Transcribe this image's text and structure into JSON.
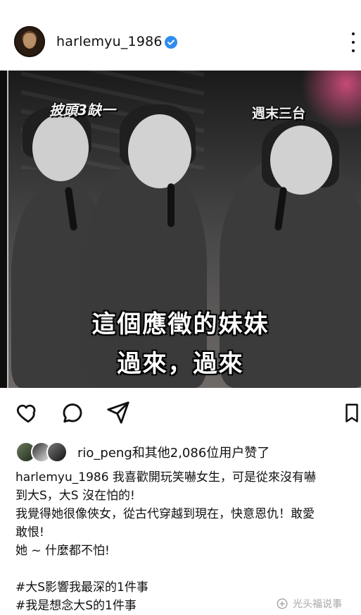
{
  "header": {
    "username": "harlemyu_1986",
    "verified": true
  },
  "post": {
    "image": {
      "overlay_logo_left": "披頭3缺一",
      "overlay_logo_right": "週末三台",
      "subtitle_line1": "這個應徵的妹妹",
      "subtitle_line2": "過來，過來"
    }
  },
  "likes": {
    "text": "rio_peng和其他2,086位用户赞了"
  },
  "caption": {
    "username": "harlemyu_1986",
    "line1": " 我喜歡開玩笑嚇女生，可是從來沒有嚇",
    "line2": "到大S，大S 沒在怕的!",
    "line3": "我覺得她很像俠女，從古代穿越到現在，快意恩仇！敢愛",
    "line4": "敢恨!",
    "line5": "她 ~ 什麼都不怕!",
    "hashtag1": "#大S影響我最深的1件事",
    "hashtag2": "#我是想念大S的1件事"
  },
  "watermark": {
    "text": "光头福说事"
  },
  "colors": {
    "verified": "#2f8cf0",
    "text": "#111111",
    "watermark": "#a7a7a7"
  },
  "icons": {
    "like": "heart-icon",
    "comment": "comment-icon",
    "share": "send-icon",
    "save": "bookmark-icon",
    "more": "more-dots-icon",
    "verified": "verified-badge-icon"
  }
}
